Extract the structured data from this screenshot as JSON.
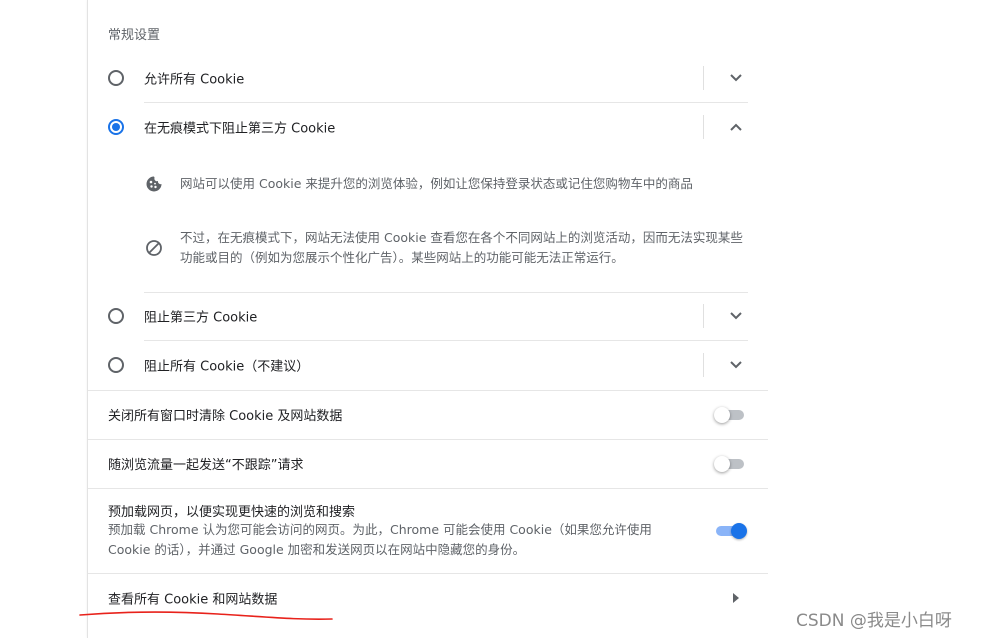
{
  "section_title": "常规设置",
  "cookie_options": [
    {
      "label": "允许所有 Cookie",
      "selected": false,
      "expanded": false
    },
    {
      "label": "在无痕模式下阻止第三方 Cookie",
      "selected": true,
      "expanded": true
    },
    {
      "label": "阻止第三方 Cookie",
      "selected": false,
      "expanded": false
    },
    {
      "label": "阻止所有 Cookie（不建议）",
      "selected": false,
      "expanded": false
    }
  ],
  "details": {
    "cookie_text": "网站可以使用 Cookie 来提升您的浏览体验，例如让您保持登录状态或记住您购物车中的商品",
    "block_text": "不过，在无痕模式下，网站无法使用 Cookie 查看您在各个不同网站上的浏览活动，因而无法实现某些功能或目的（例如为您展示个性化广告）。某些网站上的功能可能无法正常运行。"
  },
  "toggles": [
    {
      "label": "关闭所有窗口时清除 Cookie 及网站数据",
      "state": "off"
    },
    {
      "label": "随浏览流量一起发送“不跟踪”请求",
      "state": "off"
    },
    {
      "label": "预加载网页，以便实现更快速的浏览和搜索",
      "sublabel": "预加载 Chrome 认为您可能会访问的网页。为此，Chrome 可能会使用 Cookie（如果您允许使用 Cookie 的话），并通过 Google 加密和发送网页以在网站中隐藏您的身份。",
      "state": "on"
    }
  ],
  "see_all_link": "查看所有 Cookie 和网站数据",
  "watermark": "CSDN @我是小白呀",
  "colors": {
    "accent": "#1a73e8",
    "annotation": "#e8221b",
    "secondary_text": "#5f6368",
    "divider": "#e6e6e6"
  },
  "icons": {
    "expand": "chevron-down-icon",
    "collapse": "chevron-up-icon",
    "cookie": "cookie-icon",
    "block": "block-icon",
    "arrow": "arrow-right-icon"
  }
}
